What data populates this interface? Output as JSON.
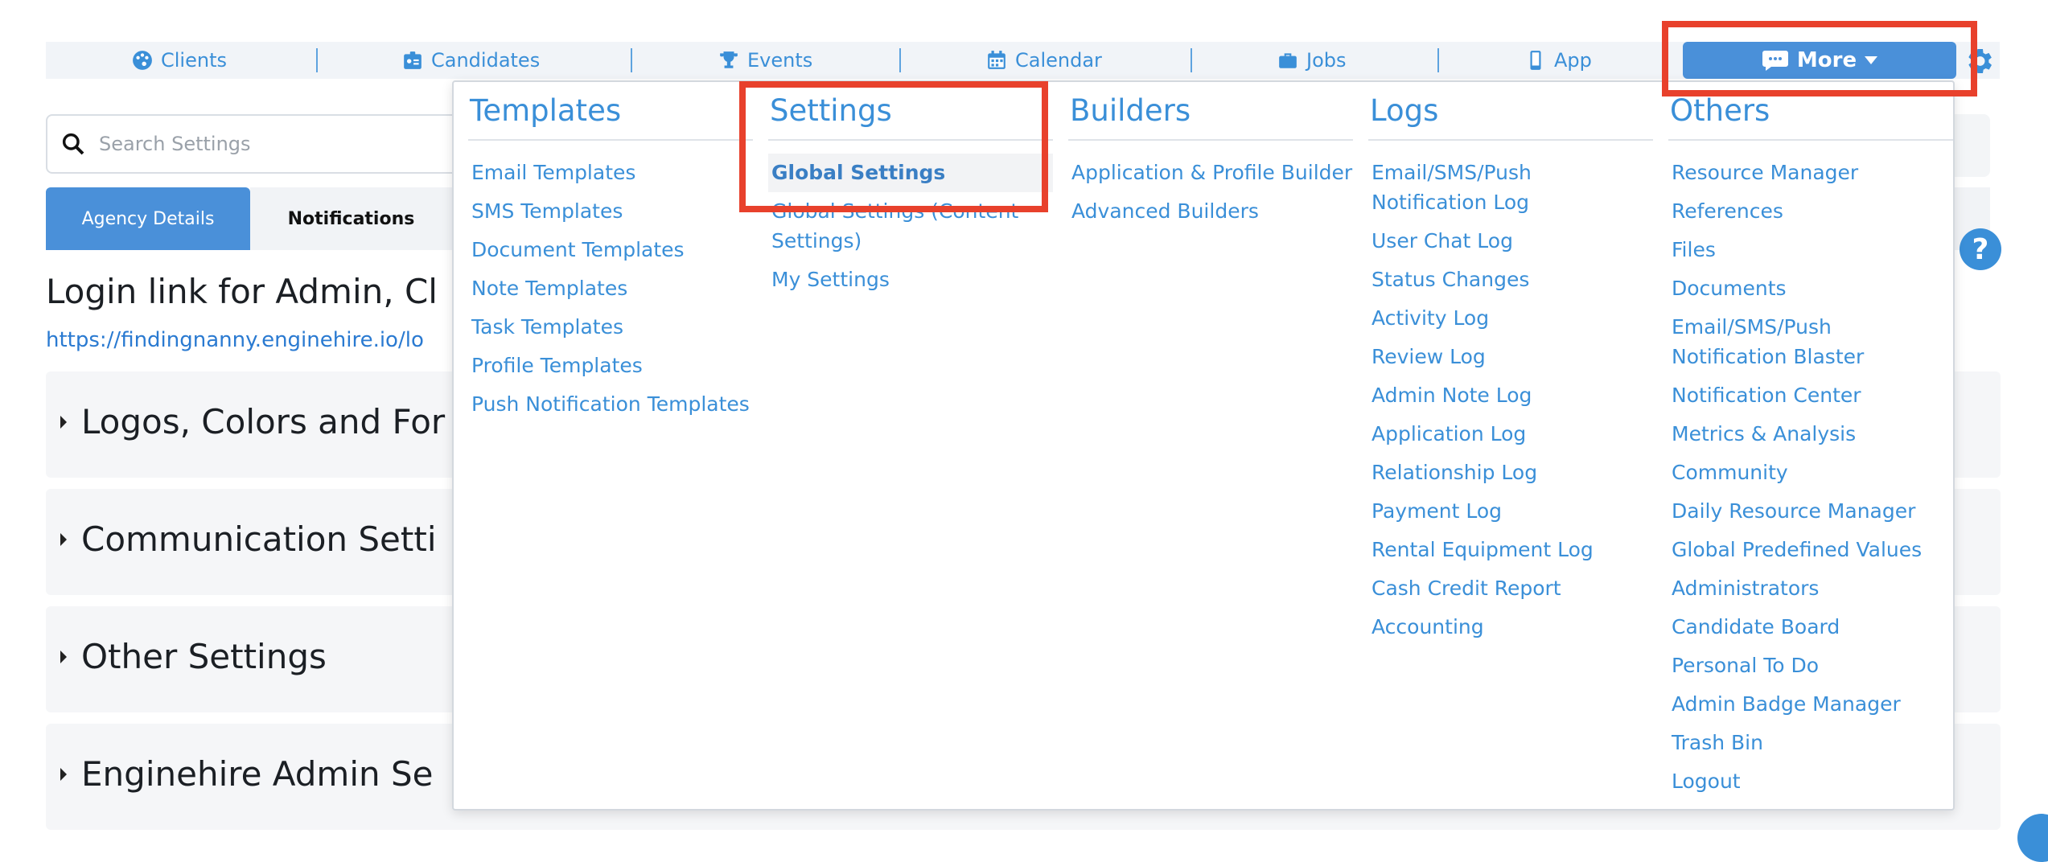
{
  "nav": {
    "items": [
      {
        "label": "Clients",
        "icon": "palette-icon"
      },
      {
        "label": "Candidates",
        "icon": "id-badge-icon"
      },
      {
        "label": "Events",
        "icon": "trophy-icon"
      },
      {
        "label": "Calendar",
        "icon": "calendar-icon"
      },
      {
        "label": "Jobs",
        "icon": "briefcase-icon"
      },
      {
        "label": "App",
        "icon": "mobile-icon"
      }
    ],
    "more_label": "More"
  },
  "search": {
    "placeholder": "Search Settings"
  },
  "tabs": [
    {
      "label": "Agency Details",
      "active": true
    },
    {
      "label": "Notifications",
      "active": false
    }
  ],
  "main": {
    "login_title": "Login link for Admin, Cl",
    "login_link": "https://findingnanny.enginehire.io/lo",
    "sections": [
      "Logos, Colors and For",
      "Communication Setti",
      "Other Settings",
      "Enginehire Admin Se"
    ]
  },
  "dropdown": {
    "columns": [
      {
        "title": "Templates",
        "items": [
          "Email Templates",
          "SMS Templates",
          "Document Templates",
          "Note Templates",
          "Task Templates",
          "Profile Templates",
          "Push Notification Templates"
        ]
      },
      {
        "title": "Settings",
        "items": [
          "Global Settings",
          "Global Settings (Content Settings)",
          "My Settings"
        ],
        "active_index": 0
      },
      {
        "title": "Builders",
        "items": [
          "Application & Profile Builder",
          "Advanced Builders"
        ]
      },
      {
        "title": "Logs",
        "items": [
          "Email/SMS/Push Notification Log",
          "User Chat Log",
          "Status Changes",
          "Activity Log",
          "Review Log",
          "Admin Note Log",
          "Application Log",
          "Relationship Log",
          "Payment Log",
          "Rental Equipment Log",
          "Cash Credit Report",
          "Accounting"
        ]
      },
      {
        "title": "Others",
        "items": [
          "Resource Manager",
          "References",
          "Files",
          "Documents",
          "Email/SMS/Push Notification Blaster",
          "Notification Center",
          "Metrics & Analysis",
          "Community",
          "Daily Resource Manager",
          "Global Predefined Values",
          "Administrators",
          "Candidate Board",
          "Personal To Do",
          "Admin Badge Manager",
          "Trash Bin",
          "Logout"
        ]
      }
    ]
  },
  "colors": {
    "accent": "#3a8fd8",
    "button": "#4a90d9",
    "highlight": "#e8412c"
  }
}
